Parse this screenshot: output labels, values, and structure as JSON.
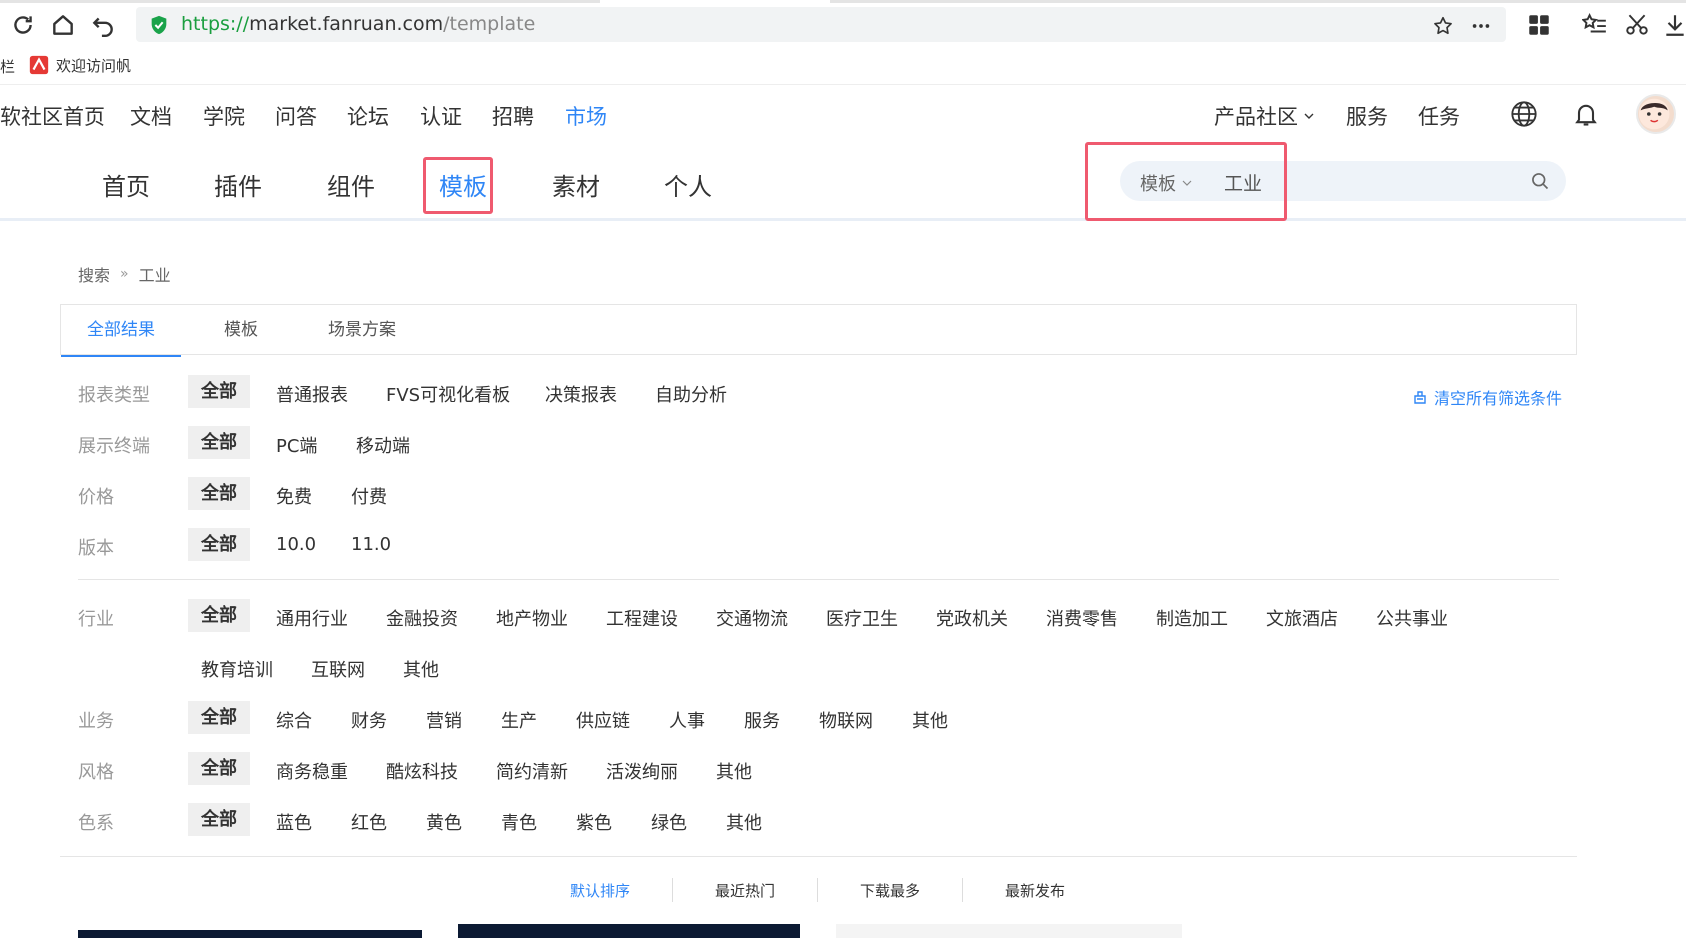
{
  "browser": {
    "url_proto": "https://",
    "url_host": "market.fanruan.com",
    "url_path": "/template",
    "bookmarks_cut_label": "栏",
    "bookmark_label": "欢迎访问帆"
  },
  "site_nav": {
    "items": [
      "软社区首页",
      "文档",
      "学院",
      "问答",
      "论坛",
      "认证",
      "招聘",
      "市场"
    ],
    "right_items": [
      "产品社区",
      "服务",
      "任务"
    ]
  },
  "market_nav": {
    "tabs": [
      "首页",
      "插件",
      "组件",
      "模板",
      "素材",
      "个人"
    ],
    "search_category": "模板",
    "search_value": "工业"
  },
  "breadcrumb": [
    "搜索",
    "»",
    "工业"
  ],
  "result_tabs": [
    "全部结果",
    "模板",
    "场景方案"
  ],
  "filters": {
    "all_label": "全部",
    "clear_label": "清空所有筛选条件",
    "report_type": {
      "label": "报表类型",
      "options": [
        "普通报表",
        "FVS可视化看板",
        "决策报表",
        "自助分析"
      ]
    },
    "terminal": {
      "label": "展示终端",
      "options": [
        "PC端",
        "移动端"
      ]
    },
    "price": {
      "label": "价格",
      "options": [
        "免费",
        "付费"
      ]
    },
    "version": {
      "label": "版本",
      "options": [
        "10.0",
        "11.0"
      ]
    },
    "industry": {
      "label": "行业",
      "options": [
        "通用行业",
        "金融投资",
        "地产物业",
        "工程建设",
        "交通物流",
        "医疗卫生",
        "党政机关",
        "消费零售",
        "制造加工",
        "文旅酒店",
        "公共事业",
        "教育培训",
        "互联网",
        "其他"
      ]
    },
    "business": {
      "label": "业务",
      "options": [
        "综合",
        "财务",
        "营销",
        "生产",
        "供应链",
        "人事",
        "服务",
        "物联网",
        "其他"
      ]
    },
    "style": {
      "label": "风格",
      "options": [
        "商务稳重",
        "酷炫科技",
        "简约清新",
        "活泼绚丽",
        "其他"
      ]
    },
    "color": {
      "label": "色系",
      "options": [
        "蓝色",
        "红色",
        "黄色",
        "青色",
        "紫色",
        "绿色",
        "其他"
      ]
    }
  },
  "sort": [
    "默认排序",
    "最近热门",
    "下载最多",
    "最新发布"
  ],
  "colors": {
    "accent": "#2f86f6",
    "highlight": "#ef5a6f"
  }
}
